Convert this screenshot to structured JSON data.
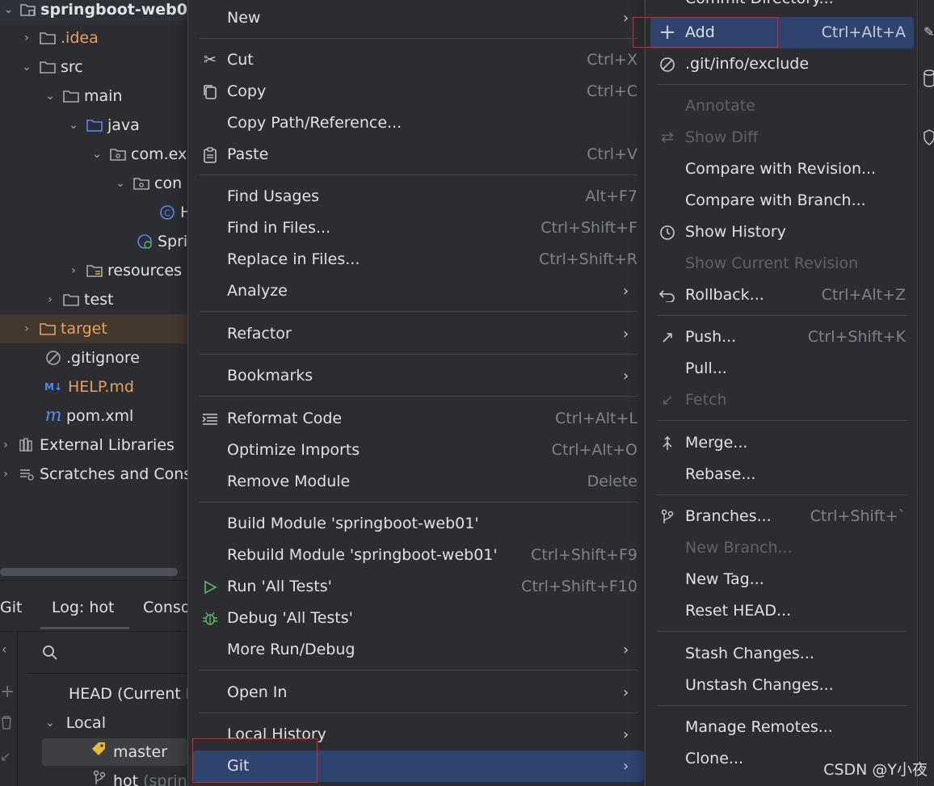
{
  "tree": {
    "root": "springboot-web0",
    "idea": ".idea",
    "src": "src",
    "main": "main",
    "java": "java",
    "pkg": "com.ex",
    "sub": "con",
    "cls": "H",
    "app": "Spri",
    "resources": "resources",
    "test": "test",
    "target": "target",
    "gitignore": ".gitignore",
    "helpmd": "HELP.md",
    "pom": "pom.xml",
    "extlibs": "External Libraries",
    "scratches": "Scratches and Cons"
  },
  "bottom": {
    "tab_git": "Git",
    "tab_log": "Log: hot",
    "tab_console": "Conso",
    "head": "HEAD (Current B",
    "local": "Local",
    "master": "master",
    "hot": "hot",
    "hot_suffix": "(sprin"
  },
  "menu1": {
    "new": "New",
    "cut": "Cut",
    "cut_sc": "Ctrl+X",
    "copy": "Copy",
    "copy_sc": "Ctrl+C",
    "copy_path": "Copy Path/Reference...",
    "paste": "Paste",
    "paste_sc": "Ctrl+V",
    "find_usages": "Find Usages",
    "find_usages_sc": "Alt+F7",
    "find_in_files": "Find in Files...",
    "find_in_files_sc": "Ctrl+Shift+F",
    "replace_in_files": "Replace in Files...",
    "replace_in_files_sc": "Ctrl+Shift+R",
    "analyze": "Analyze",
    "refactor": "Refactor",
    "bookmarks": "Bookmarks",
    "reformat": "Reformat Code",
    "reformat_sc": "Ctrl+Alt+L",
    "optimize": "Optimize Imports",
    "optimize_sc": "Ctrl+Alt+O",
    "remove_module": "Remove Module",
    "remove_module_sc": "Delete",
    "build_module": "Build Module 'springboot-web01'",
    "rebuild_module": "Rebuild Module 'springboot-web01'",
    "rebuild_module_sc": "Ctrl+Shift+F9",
    "run_tests": "Run 'All Tests'",
    "run_tests_sc": "Ctrl+Shift+F10",
    "debug_tests": "Debug 'All Tests'",
    "more_run": "More Run/Debug",
    "open_in": "Open In",
    "local_history": "Local History",
    "git": "Git"
  },
  "menu2": {
    "commit_dir": "Commit Directory...",
    "add": "Add",
    "add_sc": "Ctrl+Alt+A",
    "exclude": ".git/info/exclude",
    "annotate": "Annotate",
    "show_diff": "Show Diff",
    "compare_revision": "Compare with Revision...",
    "compare_branch": "Compare with Branch...",
    "show_history": "Show History",
    "show_current": "Show Current Revision",
    "rollback": "Rollback...",
    "rollback_sc": "Ctrl+Alt+Z",
    "push": "Push...",
    "push_sc": "Ctrl+Shift+K",
    "pull": "Pull...",
    "fetch": "Fetch",
    "merge": "Merge...",
    "rebase": "Rebase...",
    "branches": "Branches...",
    "branches_sc": "Ctrl+Shift+`",
    "new_branch": "New Branch...",
    "new_tag": "New Tag...",
    "reset_head": "Reset HEAD...",
    "stash": "Stash Changes...",
    "unstash": "Unstash Changes...",
    "manage_remotes": "Manage Remotes...",
    "clone": "Clone..."
  },
  "watermark": "CSDN @Y小夜",
  "colors": {
    "background": "#2b2d30",
    "highlight": "#2e436e",
    "annotation_red": "#e0262c",
    "excluded_orange": "#e8a060"
  }
}
